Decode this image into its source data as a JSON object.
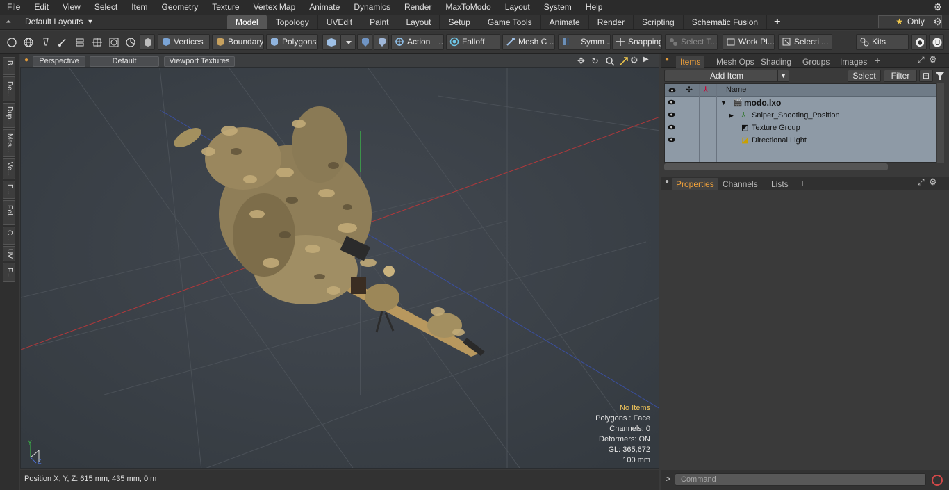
{
  "menu": [
    "File",
    "Edit",
    "View",
    "Select",
    "Item",
    "Geometry",
    "Texture",
    "Vertex Map",
    "Animate",
    "Dynamics",
    "Render",
    "MaxToModo",
    "Layout",
    "System",
    "Help"
  ],
  "layouts_label": "Default Layouts",
  "tabs": [
    "Model",
    "Topology",
    "UVEdit",
    "Paint",
    "Layout",
    "Setup",
    "Game Tools",
    "Animate",
    "Render",
    "Scripting",
    "Schematic Fusion"
  ],
  "active_tab": "Model",
  "only_label": "Only",
  "toolbar": {
    "vertices": "Vertices",
    "boundary": "Boundary",
    "polygons": "Polygons",
    "action": "Action",
    "falloff": "Falloff",
    "mesh_c": "Mesh C ...",
    "symm": "Symm ...",
    "snapping": "Snapping",
    "select_t": "Select T...",
    "work_pl": "Work Pl...",
    "selecti": "Selecti ...",
    "kits": "Kits"
  },
  "left_tabs": [
    "B...",
    "De...",
    "Dup...",
    "Mes...",
    "Ve...",
    "E...",
    "Pol...",
    "C...",
    "UV",
    "F..."
  ],
  "viewport": {
    "view": "Perspective",
    "shading": "Default",
    "textures": "Viewport Textures",
    "info": {
      "no_items": "No Items",
      "polygons": "Polygons : Face",
      "channels": "Channels: 0",
      "deformers": "Deformers: ON",
      "gl": "GL: 365,672",
      "scale": "100 mm"
    },
    "axis_y": "Y",
    "axis_z": "Z"
  },
  "status": {
    "position": "Position X, Y, Z:   615 mm, 435 mm, 0 m"
  },
  "items_panel": {
    "tabs": [
      "Items",
      "Mesh Ops",
      "Shading",
      "Groups",
      "Images"
    ],
    "active": "Items",
    "add_item": "Add Item",
    "select": "Select",
    "filter": "Filter",
    "col_name": "Name",
    "rows": [
      "modo.lxo",
      "Sniper_Shooting_Position",
      "Texture Group",
      "Directional Light"
    ]
  },
  "properties_panel": {
    "tabs": [
      "Properties",
      "Channels",
      "Lists"
    ],
    "active": "Properties"
  },
  "command": {
    "prompt": ">",
    "placeholder": "Command"
  },
  "colors": {
    "accent_orange": "#f2a23a",
    "info_yellow": "#f1c55a",
    "viewport_bg": "#3a3f45"
  }
}
